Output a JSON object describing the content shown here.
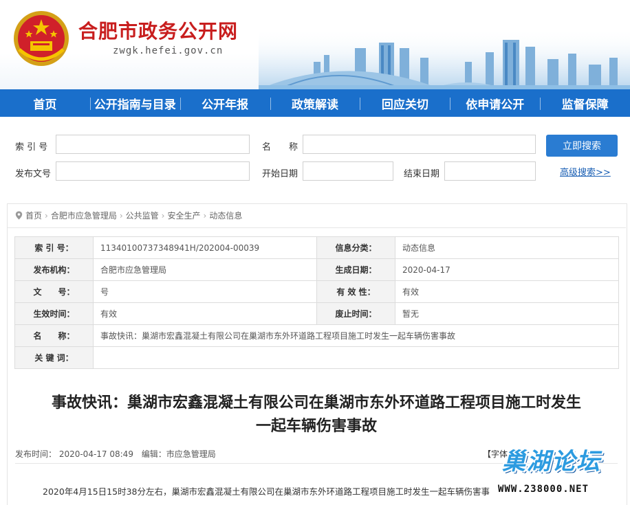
{
  "header": {
    "title": "合肥市政务公开网",
    "url": "zwgk.hefei.gov.cn"
  },
  "nav": {
    "items": [
      "首页",
      "公开指南与目录",
      "公开年报",
      "政策解读",
      "回应关切",
      "依申请公开",
      "监督保障"
    ]
  },
  "search": {
    "label_index": "索 引 号",
    "label_name": "名　　称",
    "label_doc_no": "发布文号",
    "label_start": "开始日期",
    "label_end": "结束日期",
    "button": "立即搜索",
    "advanced": "高级搜索>>"
  },
  "breadcrumb": [
    "首页",
    "合肥市应急管理局",
    "公共监管",
    "安全生产",
    "动态信息"
  ],
  "meta": {
    "index_label": "索 引 号：",
    "index_value": "11340100737348941H/202004-00039",
    "category_label": "信息分类：",
    "category_value": "动态信息",
    "org_label": "发布机构：",
    "org_value": "合肥市应急管理局",
    "date_label": "生成日期：",
    "date_value": "2020-04-17",
    "docno_label": "文　　号：",
    "docno_value": "号",
    "validity_label": "有 效 性：",
    "validity_value": "有效",
    "effective_label": "生效时间：",
    "effective_value": "有效",
    "repeal_label": "废止时间：",
    "repeal_value": "暂无",
    "name_label": "名　　称：",
    "name_value": "事故快讯：巢湖市宏鑫混凝土有限公司在巢湖市东外环道路工程项目施工时发生一起车辆伤害事故",
    "keywords_label": "关 键 词：",
    "keywords_value": ""
  },
  "article": {
    "title_line1": "事故快讯：巢湖市宏鑫混凝土有限公司在巢湖市东外环道路工程项目施工时发生",
    "title_line2": "一起车辆伤害事故",
    "publish_time": "发布时间： 2020-04-17 08:49",
    "editor": "编辑：市应急管理局",
    "font_size": "【字体",
    "body": "2020年4月15日15时38分左右，巢湖市宏鑫混凝土有限公司在巢湖市东外环道路工程项目施工时发生一起车辆伤害事"
  },
  "watermark": {
    "name": "巢湖论坛",
    "url": "WWW.238000.NET"
  },
  "colors": {
    "nav_bg": "#1a6fcb",
    "title_red": "#c81e1e",
    "button_blue": "#2a7cd2"
  }
}
